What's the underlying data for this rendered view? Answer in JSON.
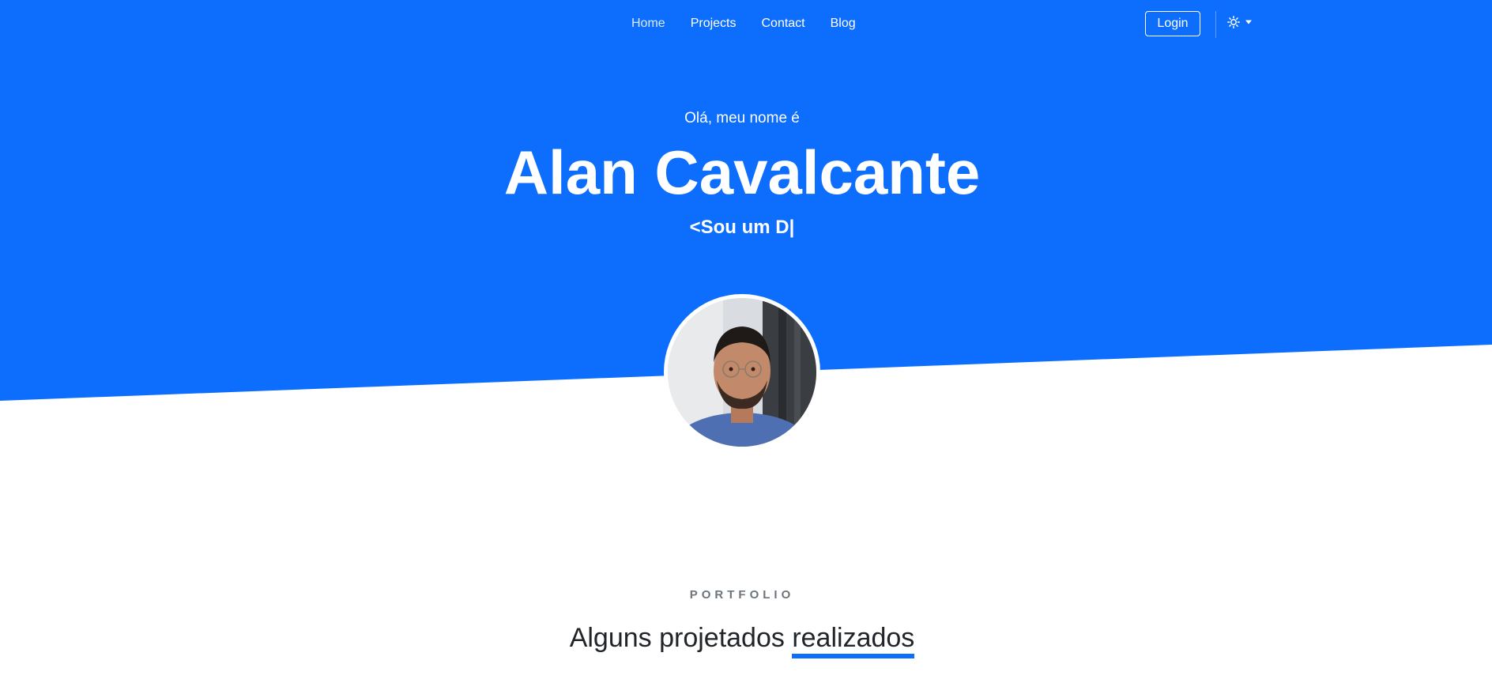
{
  "colors": {
    "brand": "#0d6efd",
    "text_dark": "#212529",
    "muted": "#6c757d",
    "white": "#ffffff"
  },
  "nav": {
    "links": [
      {
        "label": "Home"
      },
      {
        "label": "Projects"
      },
      {
        "label": "Contact"
      },
      {
        "label": "Blog"
      }
    ],
    "login_label": "Login",
    "theme_icon": "sun-icon",
    "dropdown_icon": "caret-down-icon"
  },
  "hero": {
    "greeting": "Olá, meu nome é",
    "name": "Alan Cavalcante",
    "typed_text": "<Sou um D|",
    "avatar_icon": "profile-photo"
  },
  "portfolio": {
    "eyebrow": "PORTFOLIO",
    "title_prefix": "Alguns projetados",
    "title_highlight": "realizados"
  }
}
